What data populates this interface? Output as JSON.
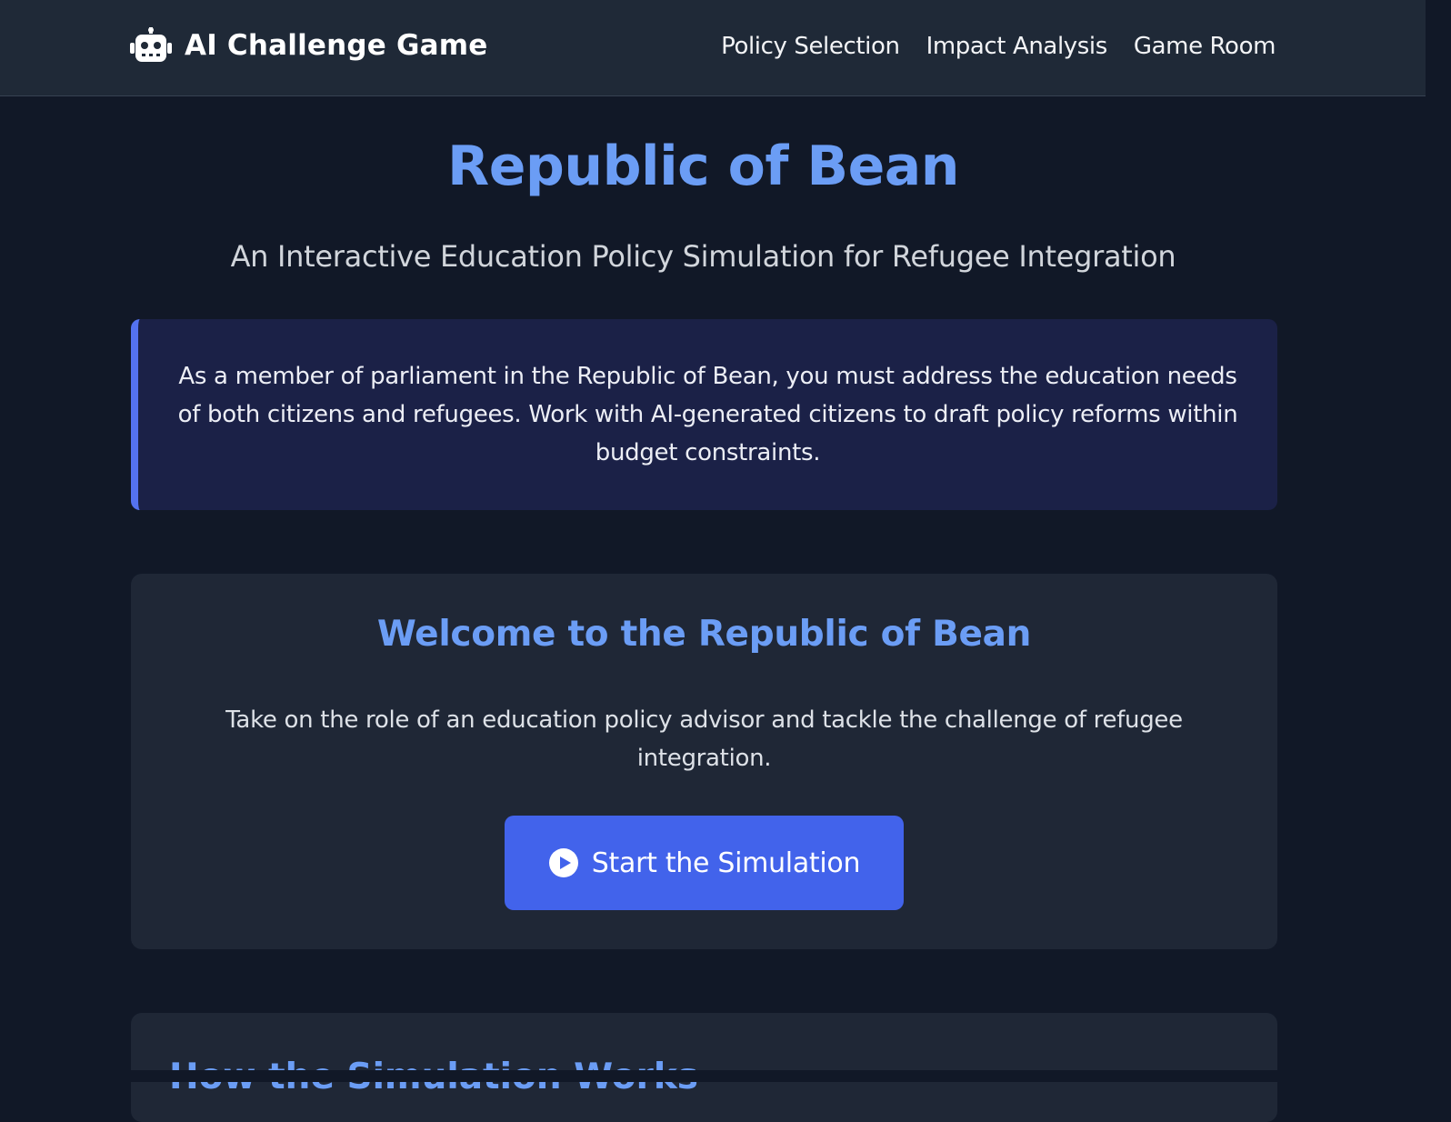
{
  "nav": {
    "brand": "AI Challenge Game",
    "brand_icon": "robot-icon",
    "links": [
      "Policy Selection",
      "Impact Analysis",
      "Game Room"
    ]
  },
  "hero": {
    "title": "Republic of Bean",
    "subtitle": "An Interactive Education Policy Simulation for Refugee Integration"
  },
  "intro": {
    "text": "As a member of parliament in the Republic of Bean, you must address the education needs of both citizens and refugees. Work with AI-generated citizens to draft policy reforms within budget constraints."
  },
  "welcome": {
    "heading": "Welcome to the Republic of Bean",
    "text": "Take on the role of an education policy advisor and tackle the challenge of refugee integration.",
    "button_label": "Start the Simulation",
    "button_icon": "play-circle-icon"
  },
  "how": {
    "heading": "How the Simulation Works"
  },
  "colors": {
    "background": "#111827",
    "navbar": "#1f2937",
    "accent": "#6b9df5",
    "button": "#4263eb",
    "intro_bg": "#1b2147",
    "intro_border": "#5472f0",
    "card": "#1f2736"
  }
}
